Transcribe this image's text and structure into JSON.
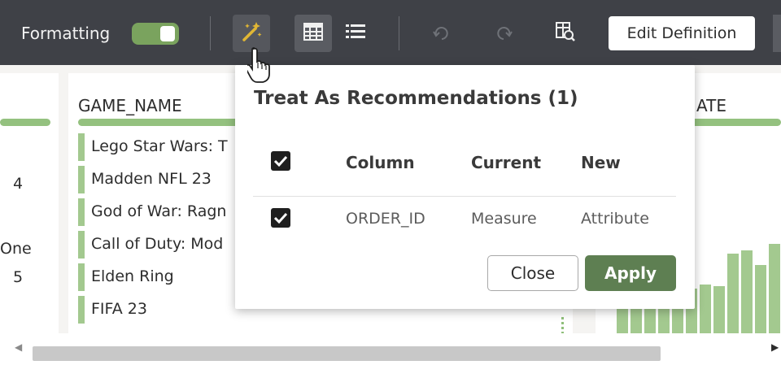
{
  "toolbar": {
    "formatting_label": "Formatting",
    "formatting_on": true,
    "edit_definition_label": "Edit Definition",
    "icons": [
      "magic-wand-icon",
      "table-view-icon",
      "list-view-icon",
      "undo-icon",
      "redo-icon",
      "data-preview-icon"
    ]
  },
  "columns": {
    "left_values": [
      "4",
      "One",
      "5"
    ],
    "game_name_header": "GAME_NAME",
    "game_names": [
      "Lego Star Wars: T",
      "Madden NFL 23",
      "God of War: Ragn",
      "Call of Duty: Mod",
      "Elden Ring",
      "FIFA 23"
    ],
    "right_header": "ATE"
  },
  "popup": {
    "title": "Treat As Recommendations (1)",
    "select_all_checked": true,
    "headers": {
      "column": "Column",
      "current": "Current",
      "new": "New"
    },
    "rows": [
      {
        "checked": true,
        "column": "ORDER_ID",
        "current": "Measure",
        "new": "Attribute"
      }
    ],
    "close_label": "Close",
    "apply_label": "Apply"
  },
  "colors": {
    "toolbar_bg": "#3f4147",
    "accent_green": "#7aa35e",
    "apply_green": "#5e7f52",
    "quality_bar": "#94c17f"
  }
}
